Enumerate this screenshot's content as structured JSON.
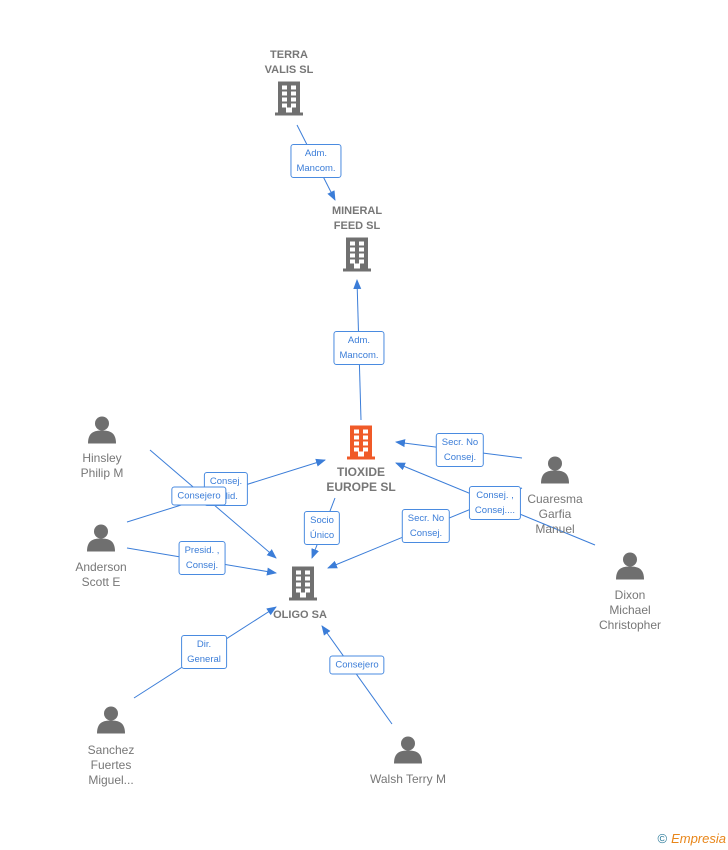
{
  "companies": [
    {
      "name": "TERRA\nVALIS SL",
      "color": "#707070"
    },
    {
      "name": "MINERAL\nFEED SL",
      "color": "#707070"
    },
    {
      "name": "TIOXIDE\nEUROPE SL",
      "color": "#f05a28"
    },
    {
      "name": "OLIGO SA",
      "color": "#707070"
    }
  ],
  "persons": [
    {
      "name": "Hinsley\nPhilip M"
    },
    {
      "name": "Anderson\nScott E"
    },
    {
      "name": "Cuaresma\nGarfia\nManuel"
    },
    {
      "name": "Dixon\nMichael\nChristopher"
    },
    {
      "name": "Sanchez\nFuertes\nMiguel..."
    },
    {
      "name": "Walsh Terry M"
    }
  ],
  "edges": [
    {
      "label": "Adm.\nMancom."
    },
    {
      "label": "Adm.\nMancom."
    },
    {
      "label": "Consej.\nSolid."
    },
    {
      "label": "Consejero"
    },
    {
      "label": "Presid. ,\nConsej."
    },
    {
      "label": "Secr. No\nConsej."
    },
    {
      "label": "Consej. ,\nConsej...."
    },
    {
      "label": "Secr. No\nConsej."
    },
    {
      "label": "Socio\nÚnico"
    },
    {
      "label": "Dir.\nGeneral"
    },
    {
      "label": "Consejero"
    }
  ],
  "footer": {
    "copyright": "©",
    "brand": "Empresia"
  }
}
